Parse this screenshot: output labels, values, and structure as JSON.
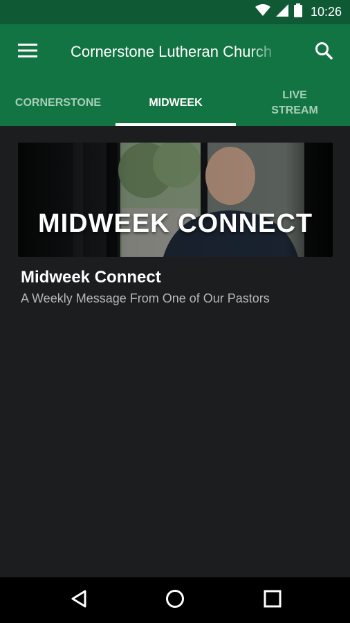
{
  "status_bar": {
    "time": "10:26",
    "icons": [
      "wifi-icon",
      "cell-signal-icon",
      "battery-icon"
    ]
  },
  "app_bar": {
    "title": "Cornerstone Lutheran Church",
    "menu_icon": "hamburger-menu-icon",
    "search_icon": "search-icon"
  },
  "tabs": [
    {
      "label": "CORNERSTONE",
      "active": false
    },
    {
      "label": "MIDWEEK",
      "active": true
    },
    {
      "label": "LIVE\nSTREAM",
      "active": false
    }
  ],
  "content": {
    "card": {
      "image_text": "MIDWEEK CONNECT",
      "title": "Midweek Connect",
      "subtitle": "A Weekly Message From One of Our Pastors"
    }
  },
  "nav_bar": {
    "icons": [
      "back-icon",
      "home-icon",
      "recents-icon"
    ]
  },
  "colors": {
    "status_bar": "#0f5a34",
    "app_bar": "#137443",
    "background": "#1c1d1f",
    "tab_inactive": "#a9cfb9",
    "tab_active": "#ffffff"
  }
}
